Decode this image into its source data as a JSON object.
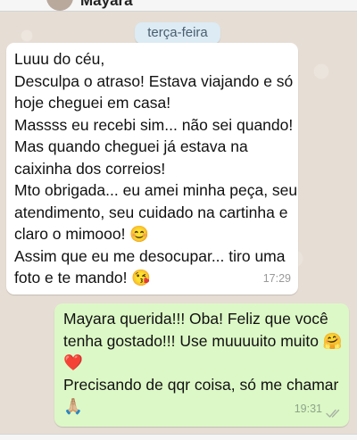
{
  "header": {
    "contact_name": "Mayara"
  },
  "chat": {
    "date_separator": "terça-feira",
    "messages": [
      {
        "direction": "incoming",
        "text": "Luuu do céu,\nDesculpa o atraso! Estava viajando e só hoje cheguei em casa!\nMassss eu recebi sim... não sei quando! Mas quando cheguei já estava na caixinha dos correios!\nMto obrigada... eu amei minha peça, seu atendimento, seu cuidado na cartinha e claro o mimooo! 😊\nAssim que eu me desocupar... tiro uma foto e te mando! 😘",
        "time": "17:29"
      },
      {
        "direction": "outgoing",
        "text": "Mayara querida!!! Oba! Feliz que você tenha gostado!!! Use muuuuito muito 🤗❤️\nPrecisando de qqr coisa, só me chamar 🙏🏼",
        "time": "19:31",
        "status_icon": "double-check-icon"
      }
    ]
  },
  "colors": {
    "chat_background": "#e6ddd4",
    "incoming_bubble": "#ffffff",
    "outgoing_bubble": "#dcf8c6",
    "date_pill": "#dcebf4"
  }
}
